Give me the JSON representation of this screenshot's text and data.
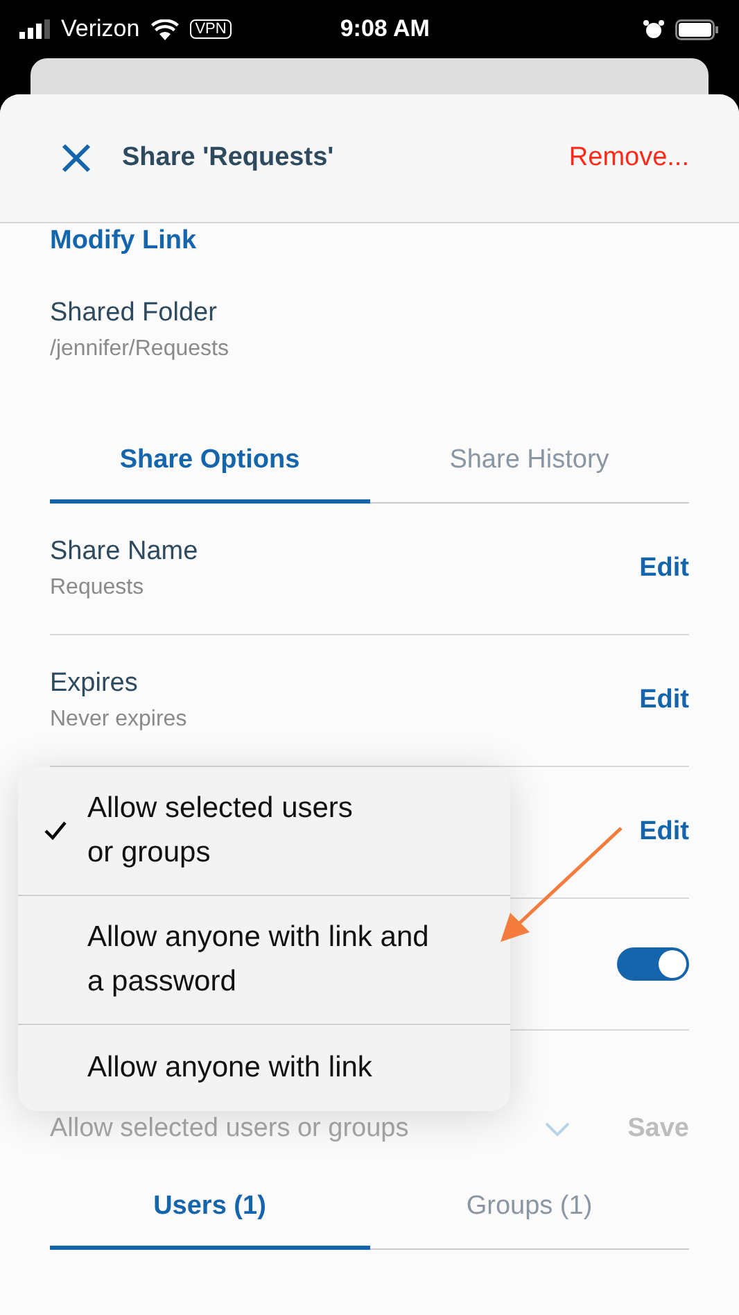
{
  "status_bar": {
    "carrier": "Verizon",
    "vpn": "VPN",
    "time": "9:08 AM"
  },
  "header": {
    "title": "Share 'Requests'",
    "action": "Remove..."
  },
  "modify_link": "Modify Link",
  "shared_folder": {
    "label": "Shared Folder",
    "path": "/jennifer/Requests"
  },
  "tabs": [
    {
      "label": "Share Options",
      "selected": true
    },
    {
      "label": "Share History",
      "selected": false
    }
  ],
  "settings": [
    {
      "kind": "edit",
      "label": "Share Name",
      "value": "Requests",
      "action": "Edit"
    },
    {
      "kind": "edit",
      "label": "Expires",
      "value": "Never expires",
      "action": "Edit"
    },
    {
      "kind": "edit",
      "action": "Edit"
    },
    {
      "kind": "toggle",
      "on": true
    }
  ],
  "permissions": {
    "value": "Allow selected users or groups",
    "save": "Save"
  },
  "bottom_tabs": [
    {
      "label": "Users (1)",
      "selected": true
    },
    {
      "label": "Groups (1)",
      "selected": false
    }
  ],
  "menu": [
    {
      "label": "Allow selected users\nor groups",
      "selected": true
    },
    {
      "label": "Allow anyone with link and\na password",
      "selected": false
    },
    {
      "label": "Allow anyone with link",
      "selected": false
    }
  ]
}
